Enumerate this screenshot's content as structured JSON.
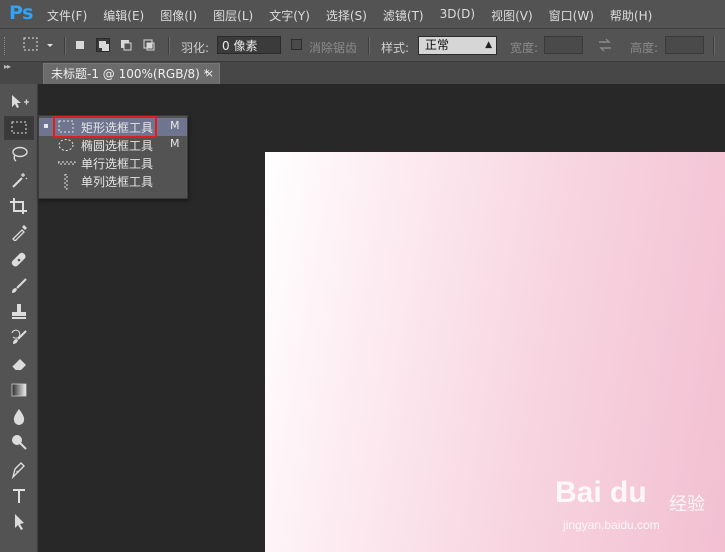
{
  "app": {
    "logo": "Ps"
  },
  "menu": [
    "文件(F)",
    "编辑(E)",
    "图像(I)",
    "图层(L)",
    "文字(Y)",
    "选择(S)",
    "滤镜(T)",
    "3D(D)",
    "视图(V)",
    "窗口(W)",
    "帮助(H)"
  ],
  "options": {
    "feather_label": "羽化:",
    "feather_value": "0 像素",
    "antialias_label": "消除锯齿",
    "style_label": "样式:",
    "style_value": "正常",
    "width_label": "宽度:",
    "height_label": "高度:"
  },
  "document": {
    "tab_title": "未标题-1 @ 100%(RGB/8) *",
    "close_glyph": "×"
  },
  "flyout": [
    {
      "label": "矩形选框工具",
      "shortcut": "M",
      "icon": "rect-marquee-icon",
      "selected": true
    },
    {
      "label": "椭圆选框工具",
      "shortcut": "M",
      "icon": "ellipse-marquee-icon",
      "selected": false
    },
    {
      "label": "单行选框工具",
      "shortcut": "",
      "icon": "single-row-marquee-icon",
      "selected": false
    },
    {
      "label": "单列选框工具",
      "shortcut": "",
      "icon": "single-column-marquee-icon",
      "selected": false
    }
  ],
  "watermark": {
    "logo": "Bai du",
    "cn": "经验",
    "url": "jingyan.baidu.com"
  },
  "colors": {
    "ui_gray": "#535353",
    "workspace": "#282828",
    "highlight": "#70758f",
    "annotation": "#e31d1d",
    "ps_blue": "#2fa3f7"
  }
}
